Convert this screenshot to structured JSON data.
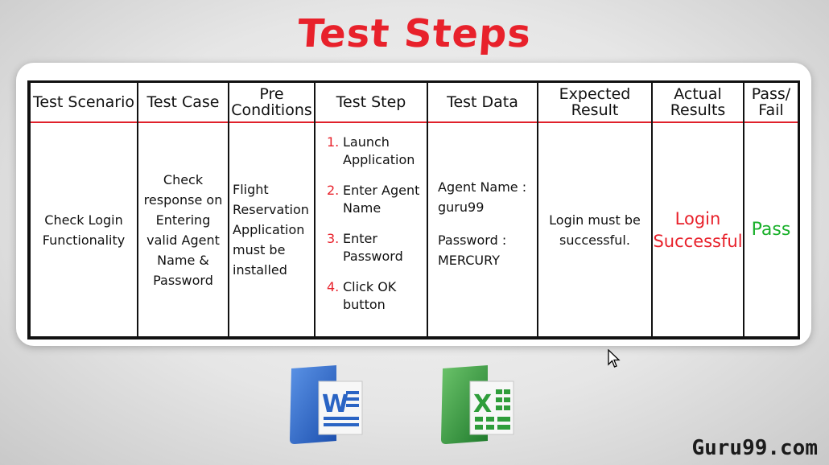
{
  "title": "Test Steps",
  "columns": {
    "scenario": {
      "header": "Test Scenario",
      "value": "Check Login Functionality"
    },
    "test_case": {
      "header": "Test Case",
      "value": "Check response on Entering valid Agent Name & Password"
    },
    "preconditions": {
      "header": "Pre Conditions",
      "value": "Flight Reservation Application must be installed"
    },
    "test_step": {
      "header": "Test Step",
      "steps": [
        {
          "num": "1.",
          "text": "Launch Application"
        },
        {
          "num": "2.",
          "text": "Enter Agent Name"
        },
        {
          "num": "3.",
          "text": "Enter Password"
        },
        {
          "num": "4.",
          "text": "Click OK button"
        }
      ]
    },
    "test_data": {
      "header": "Test Data",
      "agent_name": "Agent Name : guru99",
      "password": "Password : MERCURY"
    },
    "expected": {
      "header": "Expected Result",
      "value": "Login must be successful."
    },
    "actual": {
      "header": "Actual Results",
      "value": "Login Successful"
    },
    "pass_fail": {
      "header": "Pass/ Fail",
      "value": "Pass"
    }
  },
  "brand": "Guru99.com",
  "colors": {
    "accent_red": "#e8212b",
    "pass_green": "#19b02a",
    "word_blue": "#2a64c4",
    "excel_green": "#2e9d3a"
  },
  "icons": [
    "word-icon",
    "excel-icon",
    "cursor-icon"
  ]
}
